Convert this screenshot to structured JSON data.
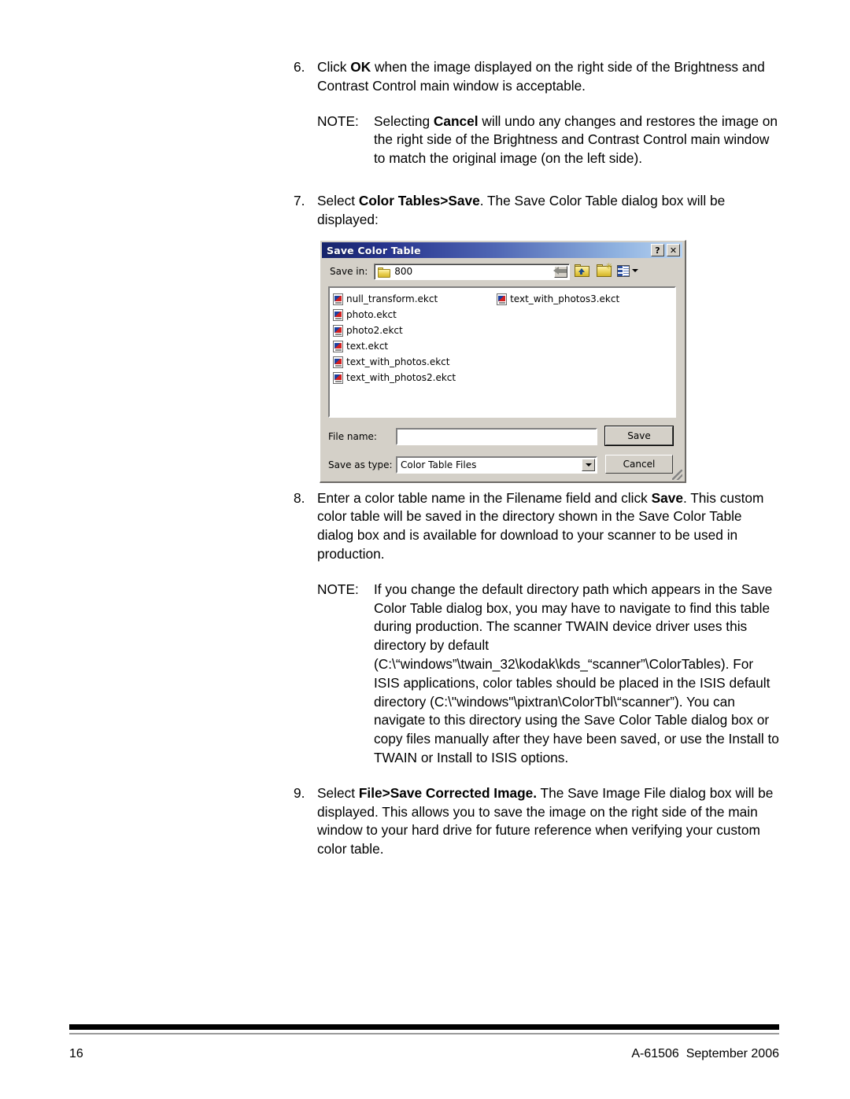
{
  "page": {
    "number": "16",
    "doc_reference": "A-61506  September 2006"
  },
  "steps": [
    {
      "num": "6.",
      "pre": "Click ",
      "bold": "OK",
      "post": " when the image displayed on the right side of the Brightness and Contrast Control main window is acceptable."
    }
  ],
  "step6": {
    "num": "6.",
    "pre": "Click ",
    "bold": "OK",
    "post": " when the image displayed on the right side of the Brightness and Contrast Control main window is acceptable."
  },
  "note1": {
    "label": "NOTE:",
    "pre": "Selecting ",
    "bold": "Cancel",
    "post": " will undo any changes and restores the image on the right side of the Brightness and Contrast Control main window to match the original image (on the left side)."
  },
  "step7": {
    "num": "7.",
    "pre": "Select ",
    "bold": "Color Tables>Save",
    "post": ". The Save Color Table dialog box will be displayed:"
  },
  "step8": {
    "num": "8.",
    "pre": "Enter a color table name in the Filename field and click ",
    "bold": "Save",
    "post": ". This custom color table will be saved in the directory shown in the Save Color Table dialog box and is available for download to your scanner to be used in production."
  },
  "note2": {
    "label": "NOTE:",
    "text": "If you change the default directory path which appears in the Save Color Table dialog box, you may have to navigate to find this table during production. The scanner TWAIN device driver uses this directory by default (C:\\“windows”\\twain_32\\kodak\\kds_“scanner”\\ColorTables). For ISIS applications, color tables should be placed in the ISIS default directory (C:\\\"windows\"\\pixtran\\ColorTbl\\“scanner”). You can navigate to this directory using the Save Color Table dialog box or copy files manually after they have been saved, or use the Install to TWAIN or Install to ISIS options."
  },
  "step9": {
    "num": "9.",
    "pre": "Select ",
    "bold": "File>Save Corrected Image.",
    "post": " The Save Image File dialog box will be displayed. This allows you to save the image on the right side of the main window to your hard drive for future reference when verifying your custom color table."
  },
  "dialog": {
    "title": "Save Color Table",
    "help_button": "?",
    "close_button": "✕",
    "save_in_label": "Save in:",
    "save_in_value": "800",
    "files_col1": [
      "null_transform.ekct",
      "photo.ekct",
      "photo2.ekct",
      "text.ekct",
      "text_with_photos.ekct",
      "text_with_photos2.ekct"
    ],
    "files_col2": [
      "text_with_photos3.ekct"
    ],
    "file_name_label": "File name:",
    "file_name_value": "",
    "save_as_type_label": "Save as type:",
    "save_as_type_value": "Color Table Files",
    "save_button": "Save",
    "cancel_button": "Cancel",
    "toolbar_icons": [
      "back-arrow-icon",
      "up-one-level-icon",
      "new-folder-icon",
      "views-icon"
    ],
    "colors": {
      "title_gradient_start": "#16246b",
      "title_gradient_end": "#b9d4f2",
      "dialog_face": "#d4d0c8"
    }
  }
}
